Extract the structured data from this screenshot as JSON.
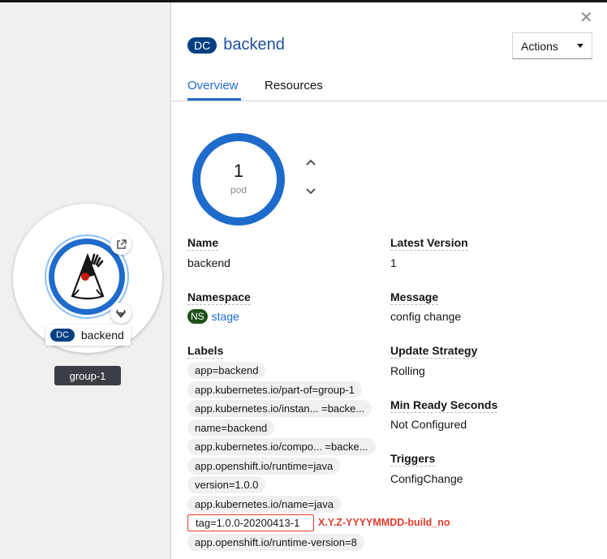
{
  "canvas": {
    "node": {
      "kind": "DC",
      "name": "backend",
      "icon": "java-duke-icon"
    },
    "group": {
      "name": "group-1"
    }
  },
  "panel": {
    "close_icon": "close-icon",
    "kind": "DC",
    "title": "backend",
    "actions_label": "Actions",
    "tabs": [
      {
        "label": "Overview"
      },
      {
        "label": "Resources"
      }
    ],
    "pods": {
      "count": "1",
      "unit": "pod"
    },
    "left": {
      "name": {
        "title": "Name",
        "value": "backend"
      },
      "namespace": {
        "title": "Namespace",
        "badge": "NS",
        "value": "stage"
      },
      "labels": {
        "title": "Labels",
        "items": [
          "app=backend",
          "app.kubernetes.io/part-of=group-1",
          "app.kubernetes.io/instan... =backe...",
          "name=backend",
          "app.kubernetes.io/compo... =backe...",
          "app.openshift.io/runtime=java",
          "version=1.0.0",
          "app.kubernetes.io/name=java",
          "tag=1.0.0-20200413-1",
          "app.openshift.io/runtime-version=8"
        ]
      }
    },
    "right": {
      "latest_version": {
        "title": "Latest Version",
        "value": "1"
      },
      "message": {
        "title": "Message",
        "value": "config change"
      },
      "update_strategy": {
        "title": "Update Strategy",
        "value": "Rolling"
      },
      "min_ready": {
        "title": "Min Ready Seconds",
        "value": "Not Configured"
      },
      "triggers": {
        "title": "Triggers",
        "value": "ConfigChange"
      }
    },
    "annotation": "X.Y.Z-YYYYMMDD-build_no"
  },
  "colors": {
    "accent": "#1f6bcc",
    "badge_dc": "#004080",
    "badge_ns": "#1e4f18",
    "highlight": "#e03e2d"
  }
}
